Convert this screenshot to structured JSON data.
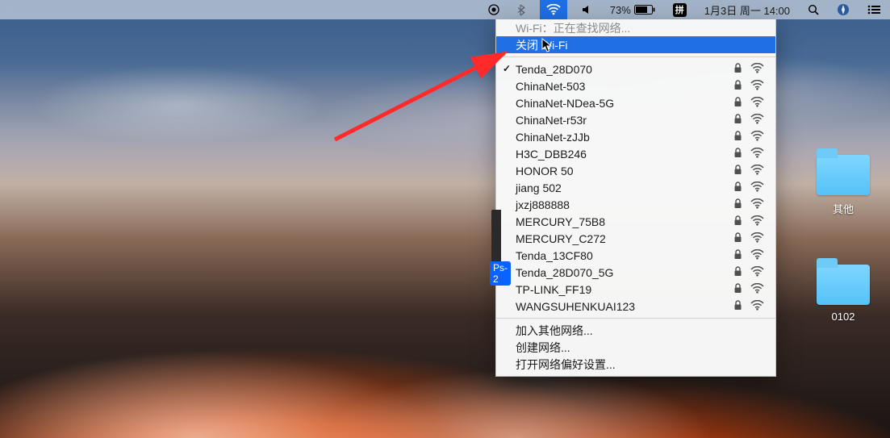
{
  "menubar": {
    "battery_pct": "73%",
    "ime_badge": "拼",
    "date_time": "1月3日 周一  14:00"
  },
  "wifi_menu": {
    "status_line": "Wi-Fi：正在查找网络...",
    "turn_off_label": "关闭 Wi-Fi",
    "connected_network": "Tenda_28D070",
    "networks": [
      {
        "name": "Tenda_28D070",
        "secured": true,
        "connected": true
      },
      {
        "name": "ChinaNet-503",
        "secured": true,
        "connected": false
      },
      {
        "name": "ChinaNet-NDea-5G",
        "secured": true,
        "connected": false
      },
      {
        "name": "ChinaNet-r53r",
        "secured": true,
        "connected": false
      },
      {
        "name": "ChinaNet-zJJb",
        "secured": true,
        "connected": false
      },
      {
        "name": "H3C_DBB246",
        "secured": true,
        "connected": false
      },
      {
        "name": "HONOR 50",
        "secured": true,
        "connected": false
      },
      {
        "name": "jiang 502",
        "secured": true,
        "connected": false
      },
      {
        "name": "jxzj888888",
        "secured": true,
        "connected": false
      },
      {
        "name": "MERCURY_75B8",
        "secured": true,
        "connected": false
      },
      {
        "name": "MERCURY_C272",
        "secured": true,
        "connected": false
      },
      {
        "name": "Tenda_13CF80",
        "secured": true,
        "connected": false
      },
      {
        "name": "Tenda_28D070_5G",
        "secured": true,
        "connected": false
      },
      {
        "name": "TP-LINK_FF19",
        "secured": true,
        "connected": false
      },
      {
        "name": "WANGSUHENKUAI123",
        "secured": true,
        "connected": false
      }
    ],
    "join_other_label": "加入其他网络...",
    "create_network_label": "创建网络...",
    "open_prefs_label": "打开网络偏好设置..."
  },
  "desktop": {
    "folders": [
      {
        "label": "其他"
      },
      {
        "label": "0102"
      }
    ],
    "partial_file_label": "Ps-2"
  },
  "colors": {
    "highlight": "#1f6fe5",
    "arrow": "#ff2a2a"
  }
}
